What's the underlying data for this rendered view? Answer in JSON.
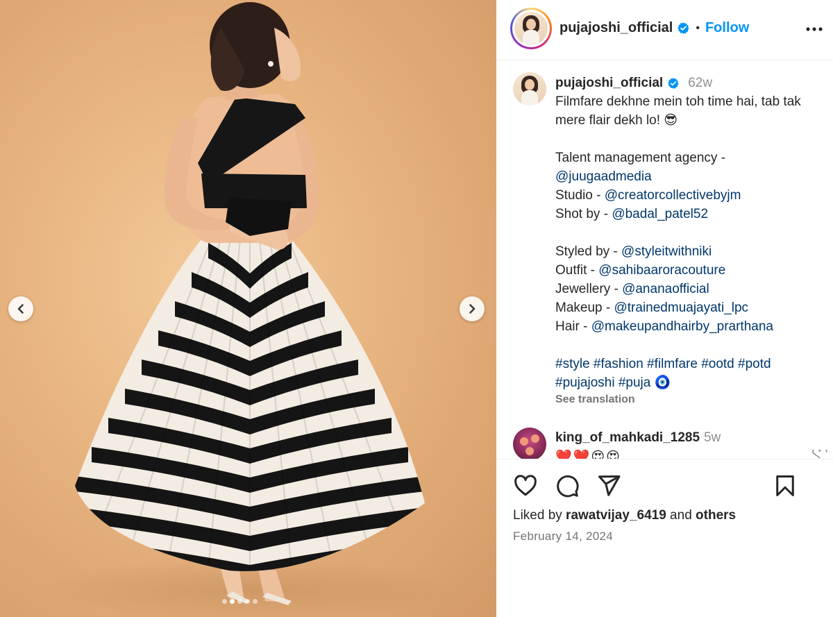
{
  "post": {
    "username": "pujajoshi_official",
    "follow_label": "Follow",
    "separator": "•",
    "media": {
      "photo": "woman-in-striped-chevron-gown-photo",
      "slide_count": 5,
      "active_slide": 2
    }
  },
  "caption": {
    "username": "pujajoshi_official",
    "time": "62w",
    "lines": [
      {
        "parts": [
          {
            "t": "text",
            "v": "Filmfare dekhne mein toh time hai, tab tak"
          }
        ]
      },
      {
        "parts": [
          {
            "t": "text",
            "v": "mere flair dekh lo! 😎"
          }
        ]
      },
      {
        "blank": true
      },
      {
        "parts": [
          {
            "t": "text",
            "v": "Talent management agency -"
          }
        ]
      },
      {
        "parts": [
          {
            "t": "mention",
            "v": "@juugaadmedia"
          }
        ]
      },
      {
        "parts": [
          {
            "t": "text",
            "v": "Studio - "
          },
          {
            "t": "mention",
            "v": "@creatorcollectivebyjm"
          }
        ]
      },
      {
        "parts": [
          {
            "t": "text",
            "v": "Shot by - "
          },
          {
            "t": "mention",
            "v": "@badal_patel52"
          }
        ]
      },
      {
        "blank": true
      },
      {
        "parts": [
          {
            "t": "text",
            "v": "Styled by - "
          },
          {
            "t": "mention",
            "v": "@styleitwithniki"
          }
        ]
      },
      {
        "parts": [
          {
            "t": "text",
            "v": "Outfit - "
          },
          {
            "t": "mention",
            "v": "@sahibaaroracouture"
          }
        ]
      },
      {
        "parts": [
          {
            "t": "text",
            "v": "Jewellery - "
          },
          {
            "t": "mention",
            "v": "@ananaofficial"
          }
        ]
      },
      {
        "parts": [
          {
            "t": "text",
            "v": "Makeup - "
          },
          {
            "t": "mention",
            "v": "@trainedmuajayati_lpc"
          }
        ]
      },
      {
        "parts": [
          {
            "t": "text",
            "v": "Hair - "
          },
          {
            "t": "mention",
            "v": "@makeupandhairby_prarthana"
          }
        ]
      },
      {
        "blank": true
      },
      {
        "parts": [
          {
            "t": "hashtag",
            "v": "#style"
          },
          {
            "t": "text",
            "v": " "
          },
          {
            "t": "hashtag",
            "v": "#fashion"
          },
          {
            "t": "text",
            "v": " "
          },
          {
            "t": "hashtag",
            "v": "#filmfare"
          },
          {
            "t": "text",
            "v": " "
          },
          {
            "t": "hashtag",
            "v": "#ootd"
          },
          {
            "t": "text",
            "v": " "
          },
          {
            "t": "hashtag",
            "v": "#potd"
          }
        ]
      },
      {
        "parts": [
          {
            "t": "hashtag",
            "v": "#pujajoshi"
          },
          {
            "t": "text",
            "v": " "
          },
          {
            "t": "hashtag",
            "v": "#puja"
          },
          {
            "t": "text",
            "v": " 🧿"
          }
        ]
      }
    ],
    "see_translation": "See translation"
  },
  "comments": [
    {
      "username": "king_of_mahkadi_1285",
      "time": "5w",
      "text": "❤️❤️😍😍"
    }
  ],
  "actions": {
    "like_icon": "heart-icon",
    "comment_icon": "comment-icon",
    "share_icon": "share-icon",
    "save_icon": "bookmark-icon"
  },
  "likes": {
    "prefix": "Liked by ",
    "user": "rawatvijay_6419",
    "middle": " and ",
    "others": "others"
  },
  "date": "February 14, 2024",
  "colors": {
    "link": "#00376b",
    "follow": "#0095f6",
    "verified": "#0095f6",
    "muted": "#737373"
  }
}
